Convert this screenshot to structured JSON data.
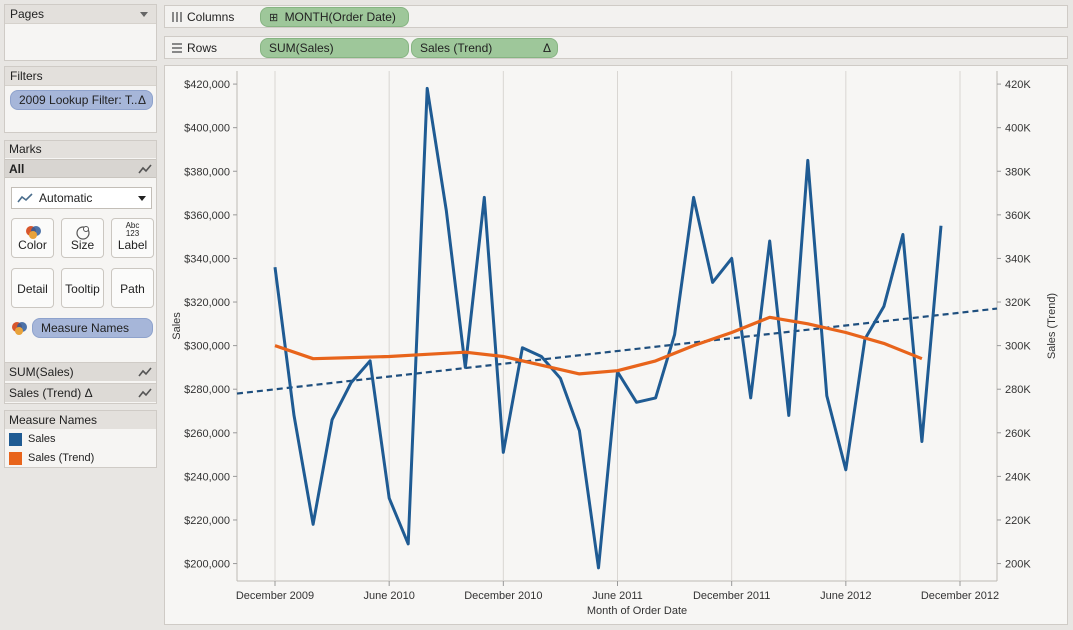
{
  "pages": {
    "title": "Pages"
  },
  "filters": {
    "title": "Filters",
    "pill": "2009 Lookup Filter: T..",
    "delta": "Δ"
  },
  "marks": {
    "title": "Marks",
    "all_label": "All",
    "mark_type": "Automatic",
    "buttons": {
      "color": "Color",
      "size": "Size",
      "label": "Label",
      "detail": "Detail",
      "tooltip": "Tooltip",
      "path": "Path",
      "label_icon_top": "Abc",
      "label_icon_bottom": "123"
    },
    "color_pill": "Measure Names",
    "strips": {
      "sum_sales": "SUM(Sales)",
      "sales_trend": "Sales (Trend)",
      "delta": "Δ"
    }
  },
  "legend": {
    "title": "Measure Names",
    "items": [
      {
        "label": "Sales",
        "color": "#1f5b93"
      },
      {
        "label": "Sales (Trend)",
        "color": "#e8641b"
      }
    ]
  },
  "shelves": {
    "columns_label": "Columns",
    "columns_pill": "MONTH(Order Date)",
    "columns_pill_expand": "⊞",
    "rows_label": "Rows",
    "rows_pill_1": "SUM(Sales)",
    "rows_pill_2": "Sales (Trend)",
    "rows_pill_2_delta": "Δ"
  },
  "chart_data": {
    "type": "line",
    "xlabel": "Month of Order Date",
    "ylabel_left": "Sales",
    "ylabel_right": "Sales (Trend)",
    "x_tick_labels": [
      "December 2009",
      "June 2010",
      "December 2010",
      "June 2011",
      "December 2011",
      "June 2012",
      "December 2012"
    ],
    "y_left_ticks": [
      "$420,000",
      "$400,000",
      "$380,000",
      "$360,000",
      "$340,000",
      "$320,000",
      "$300,000",
      "$280,000",
      "$260,000",
      "$240,000",
      "$220,000",
      "$200,000"
    ],
    "y_right_ticks": [
      "420K",
      "400K",
      "380K",
      "360K",
      "340K",
      "320K",
      "300K",
      "280K",
      "260K",
      "240K",
      "220K",
      "200K"
    ],
    "ylim": [
      192000,
      426000
    ],
    "x_months": [
      "2009-12",
      "2010-01",
      "2010-02",
      "2010-03",
      "2010-04",
      "2010-05",
      "2010-06",
      "2010-07",
      "2010-08",
      "2010-09",
      "2010-10",
      "2010-11",
      "2010-12",
      "2011-01",
      "2011-02",
      "2011-03",
      "2011-04",
      "2011-05",
      "2011-06",
      "2011-07",
      "2011-08",
      "2011-09",
      "2011-10",
      "2011-11",
      "2011-12",
      "2012-01",
      "2012-02",
      "2012-03",
      "2012-04",
      "2012-05",
      "2012-06",
      "2012-07",
      "2012-08",
      "2012-09",
      "2012-10",
      "2012-11",
      "2012-12"
    ],
    "series": [
      {
        "name": "Sales",
        "color": "#1f5b93",
        "values": [
          336000,
          268000,
          218000,
          266000,
          283000,
          293000,
          230000,
          209000,
          418000,
          362000,
          290000,
          368000,
          251000,
          299000,
          295000,
          285000,
          261000,
          198000,
          288000,
          274000,
          276000,
          305000,
          368000,
          329000,
          340000,
          276000,
          348000,
          268000,
          385000,
          277000,
          243000,
          303000,
          318000,
          351000,
          256000,
          355000
        ]
      },
      {
        "name": "Sales (Trend)",
        "color": "#e8641b",
        "values": [
          300000,
          294000,
          294500,
          295000,
          296000,
          297000,
          295000,
          291000,
          287000,
          288500,
          293000,
          300000,
          306000,
          313000,
          310000,
          306000,
          301000,
          294000
        ]
      }
    ],
    "trend_line": {
      "color": "#1f4f7e",
      "start": 278000,
      "end": 317000
    }
  }
}
